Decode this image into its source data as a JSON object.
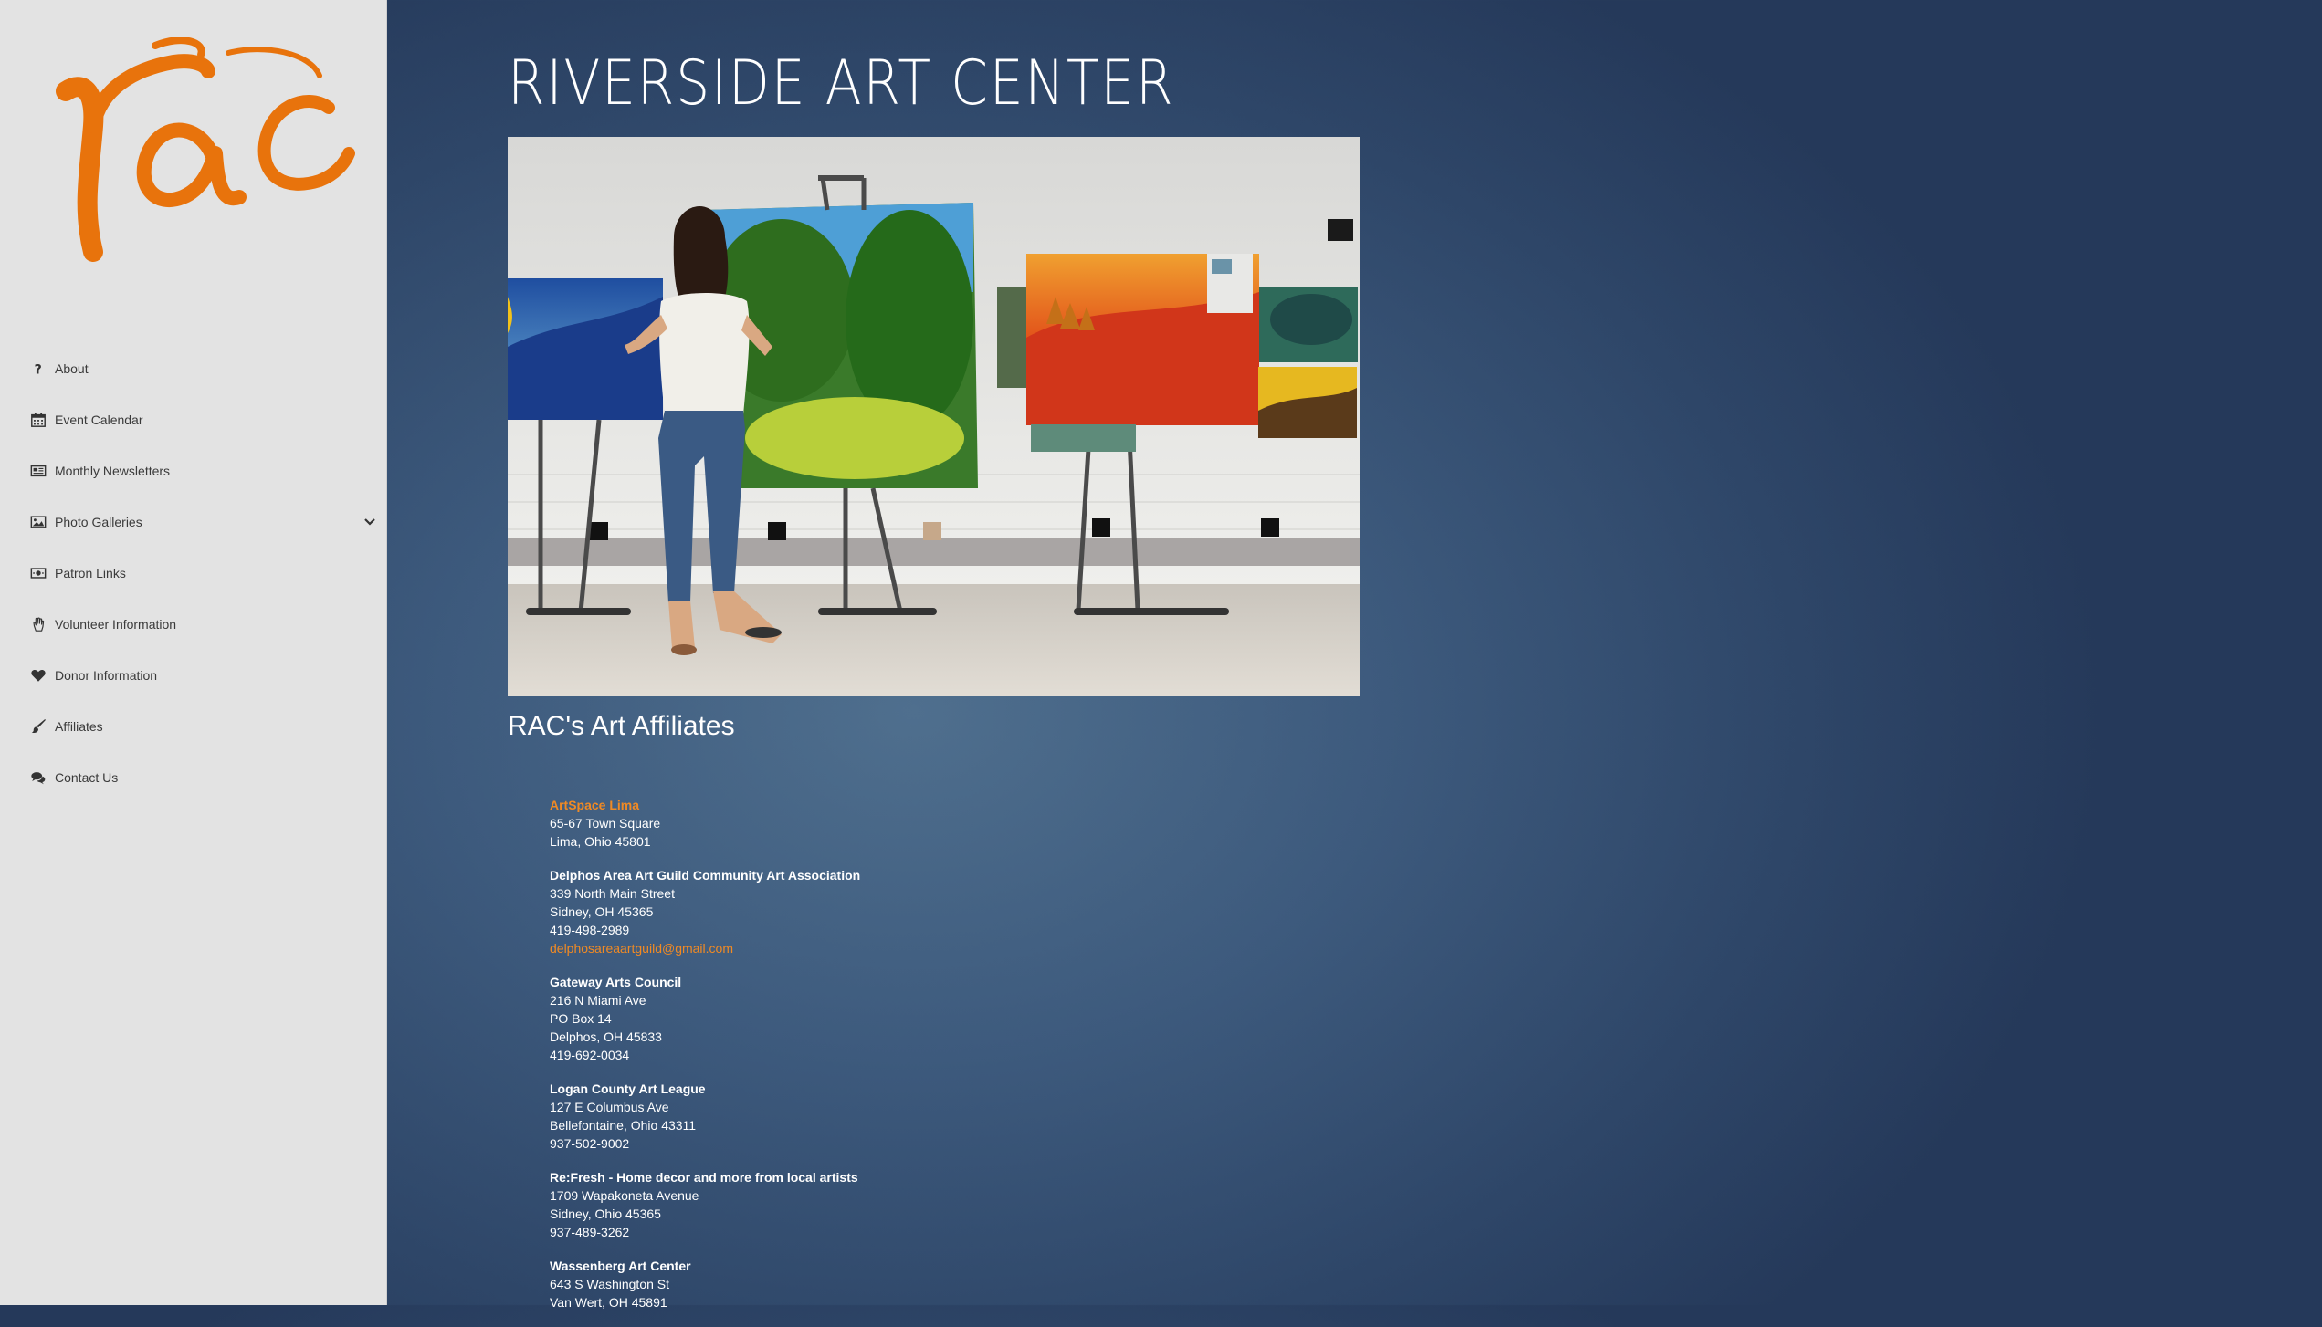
{
  "site": {
    "title": "RIVERSIDE ART CENTER",
    "logo_text": "rac",
    "accent_color": "#e8730c"
  },
  "sidebar": {
    "items": [
      {
        "label": "About",
        "icon": "question-icon"
      },
      {
        "label": "Event Calendar",
        "icon": "calendar-icon"
      },
      {
        "label": "Monthly Newsletters",
        "icon": "newspaper-icon"
      },
      {
        "label": "Photo Galleries",
        "icon": "picture-icon",
        "has_submenu": true
      },
      {
        "label": "Patron Links",
        "icon": "money-icon"
      },
      {
        "label": "Volunteer Information",
        "icon": "hand-icon"
      },
      {
        "label": "Donor Information",
        "icon": "heart-icon"
      },
      {
        "label": "Affiliates",
        "icon": "brush-icon"
      },
      {
        "label": "Contact Us",
        "icon": "comments-icon"
      }
    ]
  },
  "main": {
    "hero_image": "student painting landscapes on easels",
    "heading": "RAC's Art Affiliates",
    "affiliates": [
      {
        "name": "ArtSpace Lima",
        "name_is_link": true,
        "lines": [
          "65-67 Town Square",
          "Lima, Ohio 45801"
        ]
      },
      {
        "name": "Delphos Area Art Guild Community Art Association",
        "lines": [
          "339 North Main Street",
          "Sidney, OH 45365",
          "419-498-2989"
        ],
        "email": "delphosareaartguild@gmail.com"
      },
      {
        "name": "Gateway Arts Council",
        "lines": [
          "216 N Miami Ave",
          "PO Box 14",
          "Delphos, OH 45833",
          "419-692-0034"
        ]
      },
      {
        "name": "Logan County Art League",
        "lines": [
          "127 E Columbus Ave",
          "Bellefontaine, Ohio 43311",
          "937-502-9002"
        ]
      },
      {
        "name": "Re:Fresh - Home decor and more from local artists",
        "lines": [
          "1709 Wapakoneta Avenue",
          "Sidney, Ohio 45365",
          "937-489-3262"
        ]
      },
      {
        "name": "Wassenberg Art Center",
        "lines": [
          "643 S Washington St",
          "Van Wert, OH 45891"
        ]
      }
    ]
  }
}
